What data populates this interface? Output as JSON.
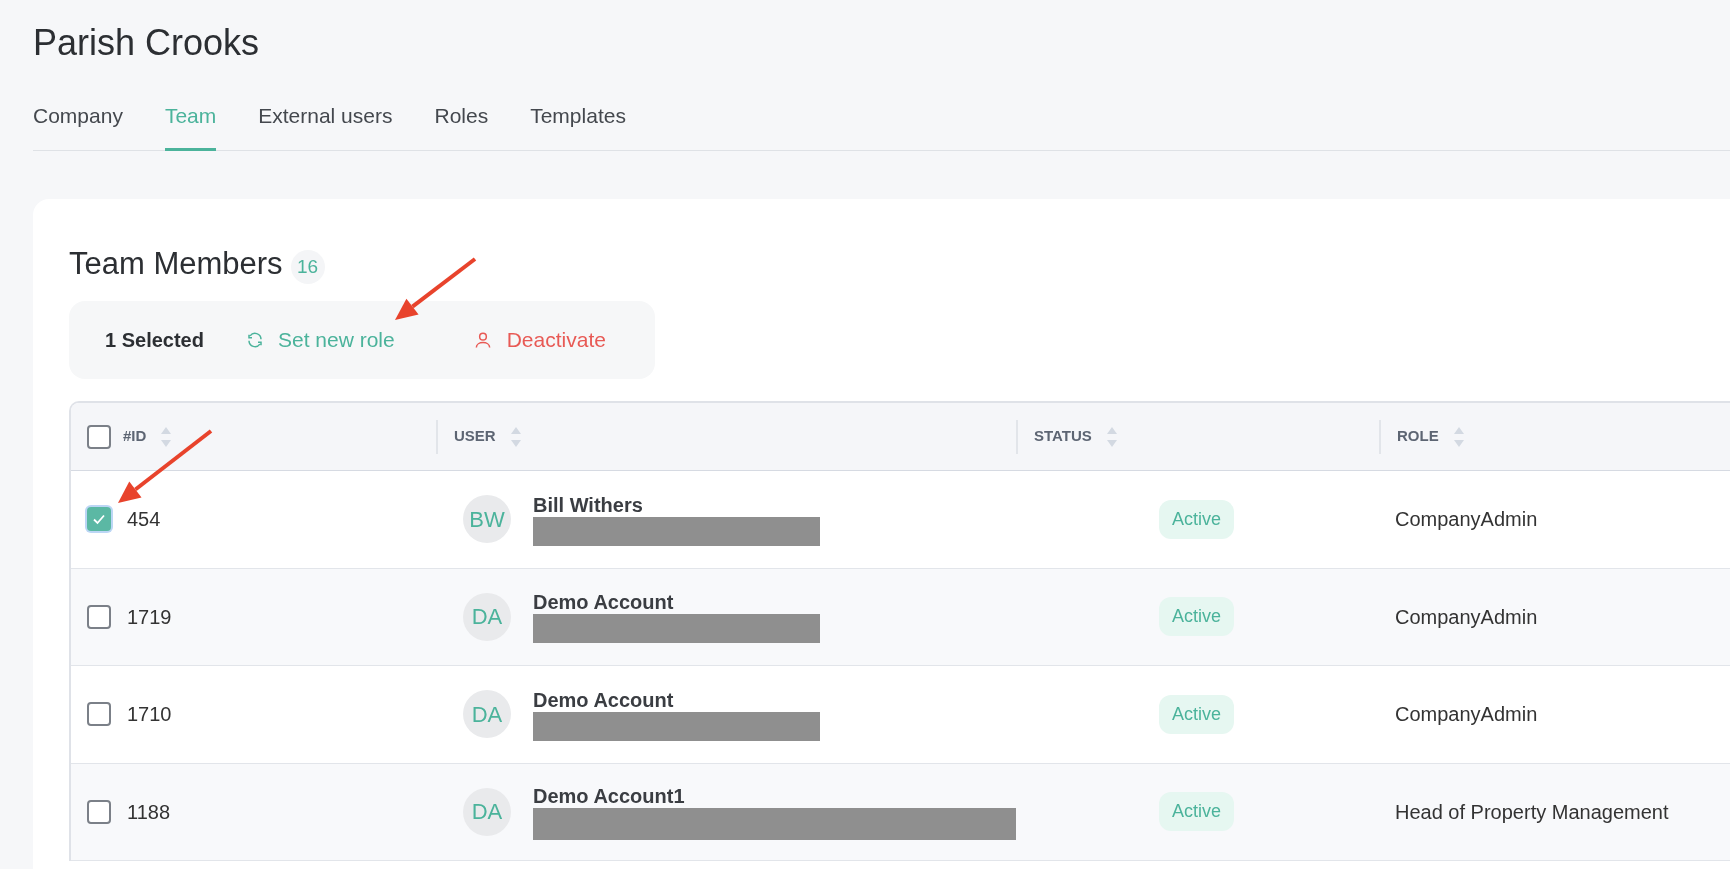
{
  "page_title": "Parish Crooks",
  "tabs": [
    {
      "label": "Company",
      "selected": false
    },
    {
      "label": "Team",
      "selected": true
    },
    {
      "label": "External users",
      "selected": false
    },
    {
      "label": "Roles",
      "selected": false
    },
    {
      "label": "Templates",
      "selected": false
    }
  ],
  "section": {
    "title": "Team Members",
    "count": "16"
  },
  "selection_bar": {
    "selected_label": "1 Selected",
    "actions": [
      {
        "kind": "role",
        "label": "Set new role"
      },
      {
        "kind": "deactivate",
        "label": "Deactivate"
      }
    ]
  },
  "table": {
    "all_checked": false,
    "columns": [
      "#ID",
      "USER",
      "STATUS",
      "ROLE"
    ],
    "rows": [
      {
        "checked": true,
        "id": "454",
        "initials": "BW",
        "name": "Bill Withers",
        "wide_redaction": false,
        "status": "Active",
        "role": "CompanyAdmin"
      },
      {
        "checked": false,
        "id": "1719",
        "initials": "DA",
        "name": "Demo Account",
        "wide_redaction": false,
        "status": "Active",
        "role": "CompanyAdmin"
      },
      {
        "checked": false,
        "id": "1710",
        "initials": "DA",
        "name": "Demo Account",
        "wide_redaction": false,
        "status": "Active",
        "role": "CompanyAdmin"
      },
      {
        "checked": false,
        "id": "1188",
        "initials": "DA",
        "name": "Demo Account1",
        "wide_redaction": true,
        "status": "Active",
        "role": "Head of Property Management"
      }
    ]
  }
}
